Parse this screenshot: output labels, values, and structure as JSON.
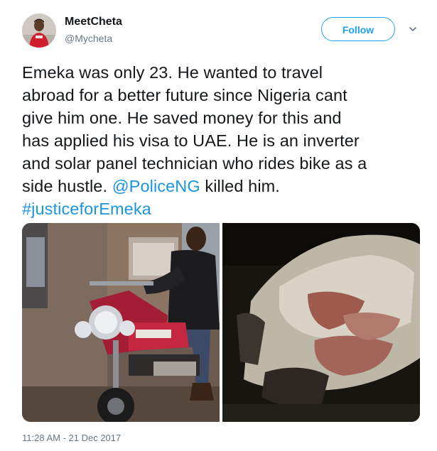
{
  "author": {
    "display_name": "MeetCheta",
    "handle": "@Mycheta"
  },
  "actions": {
    "follow_label": "Follow",
    "menu_icon": "chevron-down-icon"
  },
  "tweet": {
    "lines": [
      "Emeka was only 23. He wanted to travel",
      "abroad for a better future since Nigeria cant",
      "give him one. He saved money for this and",
      "has applied his visa to UAE. He is an inverter",
      "and solar panel technician who rides bike as a"
    ],
    "line6_before": "side hustle. ",
    "mention": "@PoliceNG",
    "line6_after": " killed him.",
    "hashtag": "#justiceforEmeka"
  },
  "timestamp": "11:28 AM - 21 Dec 2017",
  "colors": {
    "accent": "#1da1f2",
    "link": "#1b95e0",
    "secondary_text": "#657786"
  }
}
